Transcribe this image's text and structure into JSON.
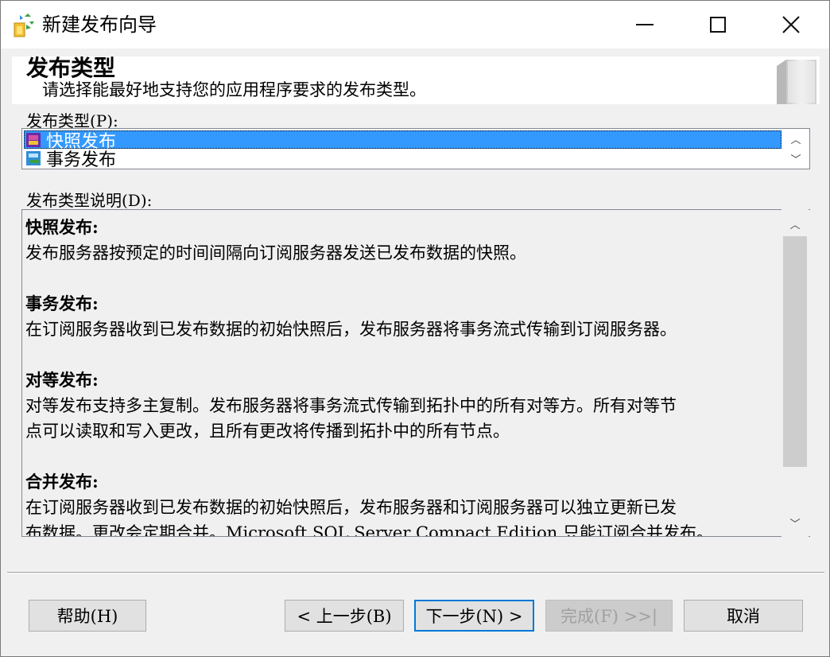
{
  "window": {
    "title": "新建发布向导"
  },
  "header": {
    "title": "发布类型",
    "subtitle": "请选择能最好地支持您的应用程序要求的发布类型。"
  },
  "publication_type": {
    "label": "发布类型(P):",
    "items": [
      {
        "label": "快照发布",
        "selected": true,
        "icon": "snapshot-publication-icon"
      },
      {
        "label": "事务发布",
        "selected": false,
        "icon": "transactional-publication-icon"
      }
    ]
  },
  "description": {
    "label": "发布类型说明(D):",
    "sections": [
      {
        "heading": "快照发布:",
        "lines": [
          "发布服务器按预定的时间间隔向订阅服务器发送已发布数据的快照。"
        ]
      },
      {
        "heading": "事务发布:",
        "lines": [
          "在订阅服务器收到已发布数据的初始快照后，发布服务器将事务流式传输到订阅服务器。"
        ]
      },
      {
        "heading": "对等发布:",
        "lines": [
          "对等发布支持多主复制。发布服务器将事务流式传输到拓扑中的所有对等方。所有对等节",
          "点可以读取和写入更改，且所有更改将传播到拓扑中的所有节点。"
        ]
      },
      {
        "heading": "合并发布:",
        "lines": [
          "在订阅服务器收到已发布数据的初始快照后，发布服务器和订阅服务器可以独立更新已发",
          "布数据。更改会定期合并。Microsoft SQL Server Compact Edition 只能订阅合并发布。"
        ]
      }
    ]
  },
  "buttons": {
    "help": "帮助(H)",
    "back": "< 上一步(B)",
    "next": "下一步(N) >",
    "finish": "完成(F) >>|",
    "cancel": "取消"
  },
  "colors": {
    "selection": "#3399ff",
    "default_button_border": "#0078d7"
  }
}
